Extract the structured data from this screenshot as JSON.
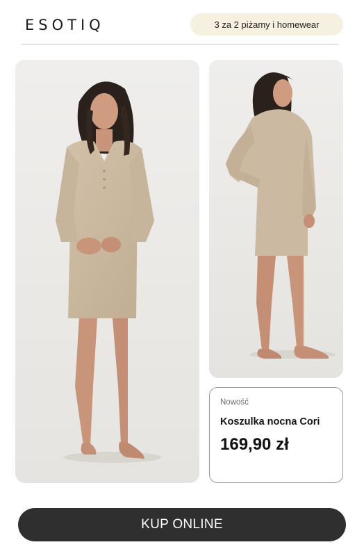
{
  "header": {
    "logo_text": "ESOTIQ",
    "promo_label": "3 za 2 piżamy i homewear"
  },
  "gallery": {
    "main_photo_icon": "product-photo-front",
    "side_photo_icon": "product-photo-side"
  },
  "product": {
    "badge": "Nowość",
    "name": "Koszulka nocna Cori",
    "price": "169,90 zł"
  },
  "cta": {
    "label": "KUP ONLINE"
  },
  "colors": {
    "promo_bg": "#f6f0e0",
    "cta_bg": "#2f2f2f",
    "garment": "#cbb9a1",
    "photo_bg": "#ecebe8"
  }
}
